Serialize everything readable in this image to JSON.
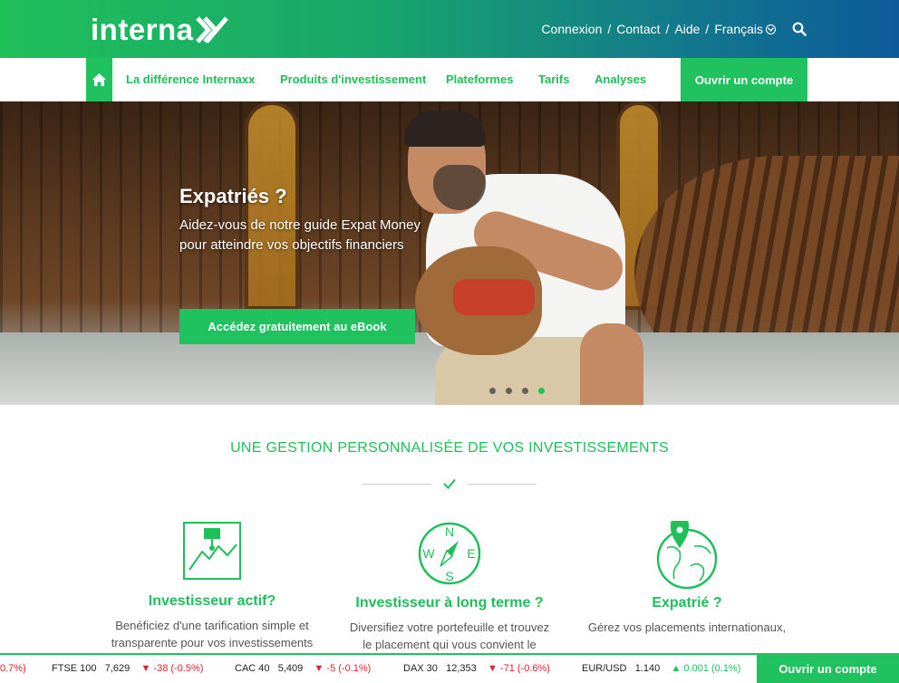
{
  "header": {
    "logo_text": "interna",
    "links": {
      "login": "Connexion",
      "contact": "Contact",
      "help": "Aide",
      "language": "Français"
    },
    "separator": "/",
    "icons": {
      "search": "search-icon",
      "language_toggle": "chevron-circle-icon"
    }
  },
  "nav": {
    "home_icon": "home-icon",
    "items": [
      {
        "label": "La différence Internaxx"
      },
      {
        "label": "Produits d'investissement"
      },
      {
        "label": "Plateformes"
      },
      {
        "label": "Tarifs"
      },
      {
        "label": "Analyses"
      }
    ],
    "cta": "Ouvrir un compte"
  },
  "hero": {
    "title": "Expatriés ?",
    "subtitle_line1": "Aidez-vous de notre guide Expat Money",
    "subtitle_line2": "pour atteindre vos objectifs financiers",
    "button": "Accédez gratuitement au eBook",
    "slides_count": 4,
    "active_slide": 4
  },
  "section": {
    "title": "UNE GESTION PERSONNALISÉE DE VOS INVESTISSEMENTS",
    "features": [
      {
        "icon": "chart-icon",
        "title": "Investisseur actif?",
        "text_line1": "Benéficiez d'une tarification simple et",
        "text_line2": "transparente pour vos investissements"
      },
      {
        "icon": "compass-icon",
        "title": "Investisseur à long terme ?",
        "text_line1": "Diversifiez votre portefeuille et trouvez",
        "text_line2": "le placement qui vous convient le"
      },
      {
        "icon": "globe-pin-icon",
        "title": "Expatrié ?",
        "text_line1": "Gérez vos placements internationaux,",
        "text_line2": ""
      }
    ]
  },
  "ticker": {
    "partial_first": "0.7%)",
    "items": [
      {
        "name": "FTSE 100",
        "value": "7,629",
        "change": "▼ -38 (-0.5%)",
        "direction": "down"
      },
      {
        "name": "CAC 40",
        "value": "5,409",
        "change": "▼ -5 (-0.1%)",
        "direction": "down"
      },
      {
        "name": "DAX 30",
        "value": "12,353",
        "change": "▼ -71 (-0.6%)",
        "direction": "down"
      },
      {
        "name": "EUR/USD",
        "value": "1.140",
        "change": "▲ 0.001 (0.1%)",
        "direction": "up"
      }
    ],
    "cta": "Ouvrir un compte"
  },
  "colors": {
    "brand_green": "#1fc25e",
    "gradient_end": "#0d5a9a",
    "down": "#e0202a"
  }
}
